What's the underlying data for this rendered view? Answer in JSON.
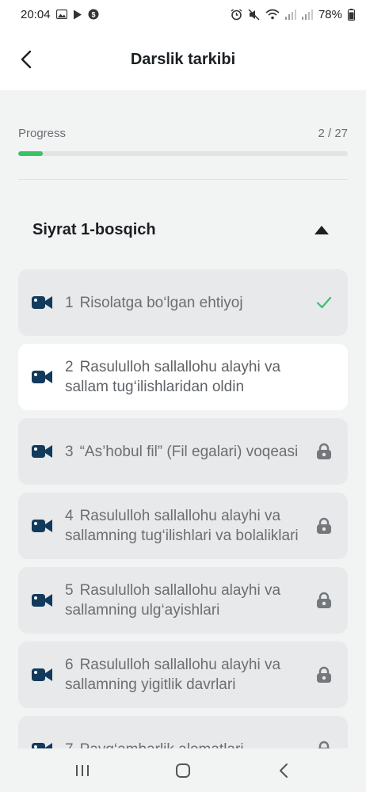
{
  "status_bar": {
    "time": "20:04",
    "battery": "78%"
  },
  "header": {
    "title": "Darslik tarkibi"
  },
  "progress": {
    "label": "Progress",
    "count": "2 / 27",
    "value": 0.074
  },
  "section": {
    "title": "Siyrat 1-bosqich",
    "expanded": true
  },
  "lessons": [
    {
      "num": "1",
      "title": "Risolatga bo‘lgan ehtiyoj",
      "state": "completed"
    },
    {
      "num": "2",
      "title": "Rasululloh sallallohu alayhi va sallam tug‘ilishlaridan oldin",
      "state": "active"
    },
    {
      "num": "3",
      "title": "“As’hobul fil” (Fil egalari) voqeasi",
      "state": "locked"
    },
    {
      "num": "4",
      "title": "Rasululloh sallallohu alayhi va sallamning tug‘ilishlari va bolaliklari",
      "state": "locked"
    },
    {
      "num": "5",
      "title": "Rasululloh sallallohu alayhi va sallamning ulg‘ayishlari",
      "state": "locked"
    },
    {
      "num": "6",
      "title": "Rasululloh sallallohu alayhi va sallamning yigitlik davrlari",
      "state": "locked"
    },
    {
      "num": "7",
      "title": "Payg‘ambarlik alomatlari",
      "state": "locked"
    }
  ],
  "colors": {
    "accent": "#35c466",
    "icon": "#123a5c",
    "lock": "#74787c"
  }
}
